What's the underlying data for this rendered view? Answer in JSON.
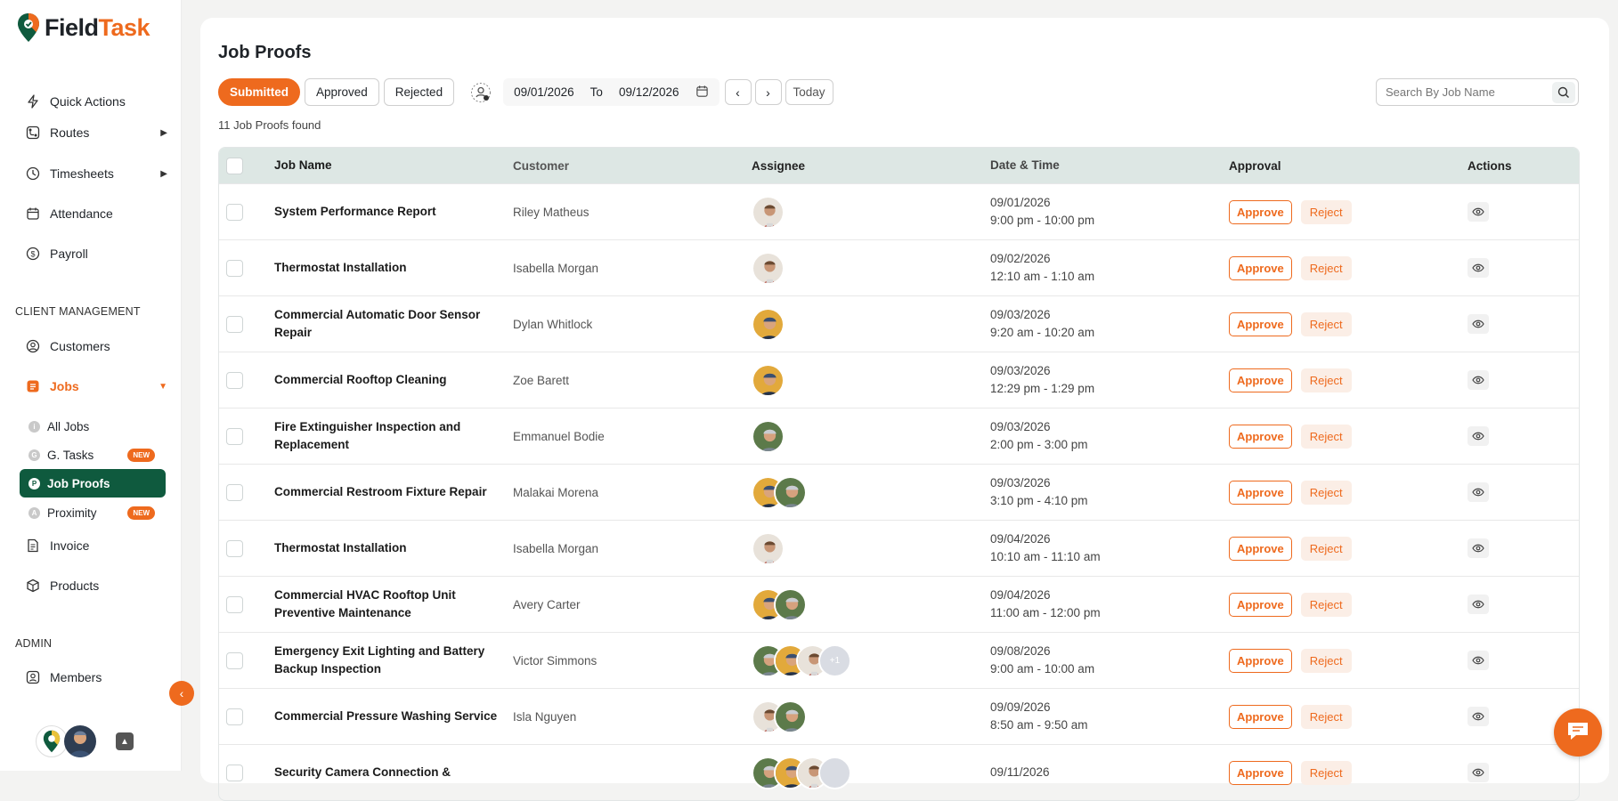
{
  "brand": {
    "name_part1": "Field",
    "name_part2": "Task",
    "accent": "#ee6a1e",
    "primary": "#0f5a3e"
  },
  "sidebar": {
    "top_items": [
      {
        "label": "Quick Actions",
        "icon": "bolt-icon"
      },
      {
        "label": "Routes",
        "icon": "routes-icon",
        "has_submenu": true
      },
      {
        "label": "Timesheets",
        "icon": "clock-icon",
        "has_submenu": true
      },
      {
        "label": "Attendance",
        "icon": "calendar-icon"
      },
      {
        "label": "Payroll",
        "icon": "dollar-icon"
      }
    ],
    "client_section": "CLIENT MANAGEMENT",
    "customers": "Customers",
    "jobs": "Jobs",
    "job_sub": [
      {
        "label": "All Jobs",
        "letter": "i"
      },
      {
        "label": "G. Tasks",
        "letter": "G",
        "badge": "NEW"
      },
      {
        "label": "Job Proofs",
        "letter": "P",
        "active": true
      },
      {
        "label": "Proximity",
        "letter": "A",
        "badge": "NEW"
      }
    ],
    "invoice": "Invoice",
    "products": "Products",
    "admin_section": "ADMIN",
    "members": "Members"
  },
  "page": {
    "title": "Job Proofs",
    "tabs": [
      "Submitted",
      "Approved",
      "Rejected"
    ],
    "active_tab": "Submitted",
    "date_from": "09/01/2026",
    "date_to_label": "To",
    "date_to": "09/12/2026",
    "today": "Today",
    "search_placeholder": "Search By Job Name",
    "count_text": "11 Job Proofs found"
  },
  "table": {
    "headers": [
      "Job Name",
      "Customer",
      "Assignee",
      "Date & Time",
      "Approval",
      "Actions"
    ],
    "approve_label": "Approve",
    "reject_label": "Reject",
    "rows": [
      {
        "job": "System Performance Report",
        "customer": "Riley Matheus",
        "date": "09/01/2026",
        "time": "9:00 pm - 10:00 pm",
        "assignees": [
          "a"
        ]
      },
      {
        "job": "Thermostat Installation",
        "customer": "Isabella Morgan",
        "date": "09/02/2026",
        "time": "12:10 am - 1:10 am",
        "assignees": [
          "a"
        ]
      },
      {
        "job": "Commercial Automatic Door Sensor Repair",
        "customer": "Dylan Whitlock",
        "date": "09/03/2026",
        "time": "9:20 am - 10:20 am",
        "assignees": [
          "b"
        ]
      },
      {
        "job": "Commercial Rooftop Cleaning",
        "customer": "Zoe Barett",
        "date": "09/03/2026",
        "time": "12:29 pm - 1:29 pm",
        "assignees": [
          "b"
        ]
      },
      {
        "job": "Fire Extinguisher Inspection and Replacement",
        "customer": "Emmanuel Bodie",
        "date": "09/03/2026",
        "time": "2:00 pm - 3:00 pm",
        "assignees": [
          "c"
        ]
      },
      {
        "job": "Commercial Restroom Fixture Repair",
        "customer": "Malakai Morena",
        "date": "09/03/2026",
        "time": "3:10 pm - 4:10 pm",
        "assignees": [
          "b",
          "c"
        ]
      },
      {
        "job": "Thermostat Installation",
        "customer": "Isabella Morgan",
        "date": "09/04/2026",
        "time": "10:10 am - 11:10 am",
        "assignees": [
          "a"
        ]
      },
      {
        "job": "Commercial HVAC Rooftop Unit Preventive Maintenance",
        "customer": "Avery Carter",
        "date": "09/04/2026",
        "time": "11:00 am - 12:00 pm",
        "assignees": [
          "b",
          "c"
        ]
      },
      {
        "job": "Emergency Exit Lighting and Battery Backup Inspection",
        "customer": "Victor Simmons",
        "date": "09/08/2026",
        "time": "9:00 am - 10:00 am",
        "assignees": [
          "c",
          "b",
          "a"
        ],
        "more": "+1"
      },
      {
        "job": "Commercial Pressure Washing Service",
        "customer": "Isla Nguyen",
        "date": "09/09/2026",
        "time": "8:50 am - 9:50 am",
        "assignees": [
          "a",
          "c"
        ]
      },
      {
        "job": "Security Camera Connection &",
        "customer": "",
        "date": "09/11/2026",
        "time": "",
        "assignees": [
          "c",
          "b",
          "a"
        ],
        "more": ""
      }
    ]
  }
}
